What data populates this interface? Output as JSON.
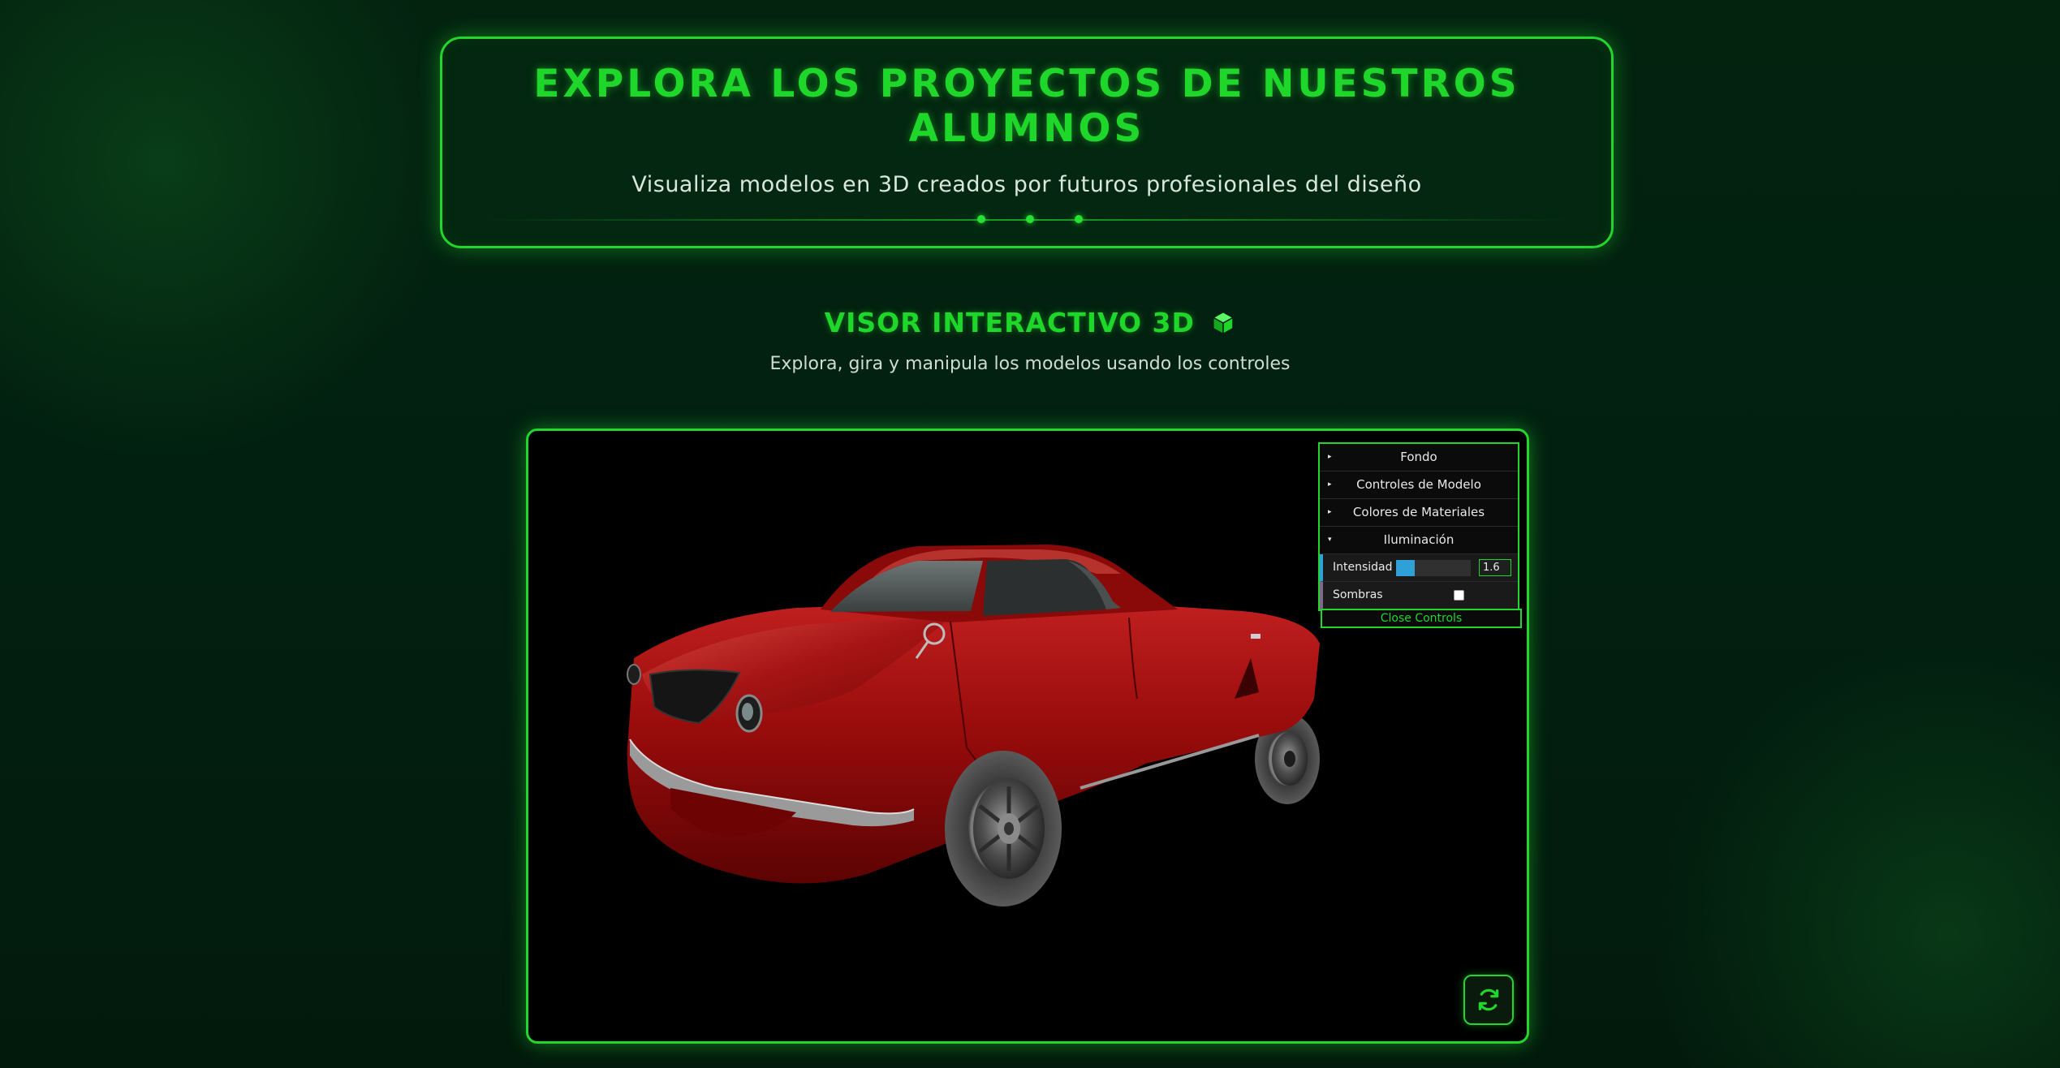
{
  "hero": {
    "title": "EXPLORA LOS PROYECTOS DE NUESTROS ALUMNOS",
    "subtitle": "Visualiza modelos en 3D creados por futuros profesionales del diseño"
  },
  "viewer_section": {
    "title": "VISOR INTERACTIVO 3D",
    "title_icon": "cube-icon",
    "subtitle": "Explora, gira y manipula los modelos usando los controles"
  },
  "gui": {
    "folders": [
      {
        "label": "Fondo",
        "expanded": false
      },
      {
        "label": "Controles de Modelo",
        "expanded": false
      },
      {
        "label": "Colores de Materiales",
        "expanded": false
      },
      {
        "label": "Iluminación",
        "expanded": true
      }
    ],
    "intensity": {
      "label": "Intensidad",
      "value": "1.6",
      "fill_fraction": 0.25
    },
    "shadows": {
      "label": "Sombras",
      "checked": false
    },
    "close_label": "Close Controls"
  },
  "viewer": {
    "model_color": "#8b0000",
    "reset_icon": "refresh-icon"
  },
  "colors": {
    "accent": "#22d62e",
    "background": "#021a0c",
    "slider": "#2fa1d6"
  }
}
